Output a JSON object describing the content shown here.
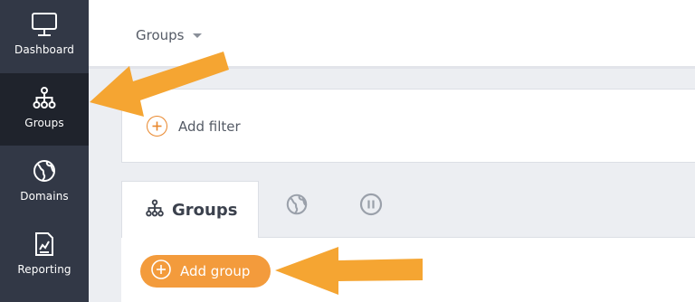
{
  "sidebar": {
    "items": [
      {
        "label": "Dashboard",
        "icon": "monitor-icon",
        "active": false
      },
      {
        "label": "Groups",
        "icon": "hierarchy-icon",
        "active": true
      },
      {
        "label": "Domains",
        "icon": "globe-icon",
        "active": false
      },
      {
        "label": "Reporting",
        "icon": "report-chart-icon",
        "active": false
      }
    ]
  },
  "header": {
    "scope_label": "Groups"
  },
  "filter": {
    "add_filter_label": "Add filter"
  },
  "tabs": {
    "active_label": "Groups",
    "icon_tabs": [
      "globe-icon",
      "pause-icon"
    ]
  },
  "actions": {
    "add_group_label": "Add group"
  },
  "colors": {
    "sidebar_bg": "#323846",
    "sidebar_active_bg": "#1f232c",
    "accent_orange": "#f39b3c",
    "annotation_arrow": "#f5a532"
  }
}
